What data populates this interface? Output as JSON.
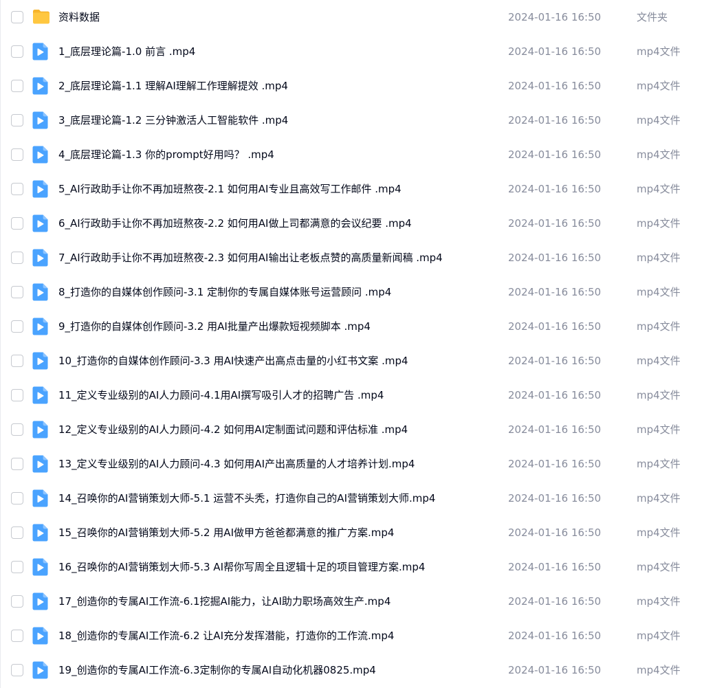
{
  "colors": {
    "video_icon": "#4aa3ff",
    "folder_icon": "#ffc740",
    "text_primary": "#03081a",
    "text_secondary": "#878c9c"
  },
  "files": [
    {
      "name": "资料数据",
      "date": "2024-01-16 16:50",
      "type": "文件夹",
      "icon": "folder-icon"
    },
    {
      "name": "1_底层理论篇-1.0 前言 .mp4",
      "date": "2024-01-16 16:50",
      "type": "mp4文件",
      "icon": "video-file-icon"
    },
    {
      "name": "2_底层理论篇-1.1 理解AI理解工作理解提效 .mp4",
      "date": "2024-01-16 16:50",
      "type": "mp4文件",
      "icon": "video-file-icon"
    },
    {
      "name": "3_底层理论篇-1.2 三分钟激活人工智能软件 .mp4",
      "date": "2024-01-16 16:50",
      "type": "mp4文件",
      "icon": "video-file-icon"
    },
    {
      "name": "4_底层理论篇-1.3 你的prompt好用吗？ .mp4",
      "date": "2024-01-16 16:50",
      "type": "mp4文件",
      "icon": "video-file-icon"
    },
    {
      "name": "5_AI行政助手让你不再加班熬夜-2.1 如何用AI专业且高效写工作邮件 .mp4",
      "date": "2024-01-16 16:50",
      "type": "mp4文件",
      "icon": "video-file-icon"
    },
    {
      "name": "6_AI行政助手让你不再加班熬夜-2.2 如何用AI做上司都满意的会议纪要 .mp4",
      "date": "2024-01-16 16:50",
      "type": "mp4文件",
      "icon": "video-file-icon"
    },
    {
      "name": "7_AI行政助手让你不再加班熬夜-2.3 如何用AI输出让老板点赞的高质量新闻稿 .mp4",
      "date": "2024-01-16 16:50",
      "type": "mp4文件",
      "icon": "video-file-icon"
    },
    {
      "name": "8_打造你的自媒体创作顾问-3.1 定制你的专属自媒体账号运营顾问 .mp4",
      "date": "2024-01-16 16:50",
      "type": "mp4文件",
      "icon": "video-file-icon"
    },
    {
      "name": "9_打造你的自媒体创作顾问-3.2 用AI批量产出爆款短视频脚本 .mp4",
      "date": "2024-01-16 16:50",
      "type": "mp4文件",
      "icon": "video-file-icon"
    },
    {
      "name": "10_打造你的自媒体创作顾问-3.3 用AI快速产出高点击量的小红书文案 .mp4",
      "date": "2024-01-16 16:50",
      "type": "mp4文件",
      "icon": "video-file-icon"
    },
    {
      "name": "11_定义专业级别的AI人力顾问-4.1用AI撰写吸引人才的招聘广告 .mp4",
      "date": "2024-01-16 16:50",
      "type": "mp4文件",
      "icon": "video-file-icon"
    },
    {
      "name": "12_定义专业级别的AI人力顾问-4.2 如何用AI定制面试问题和评估标准 .mp4",
      "date": "2024-01-16 16:50",
      "type": "mp4文件",
      "icon": "video-file-icon"
    },
    {
      "name": "13_定义专业级别的AI人力顾问-4.3 如何用AI产出高质量的人才培养计划.mp4",
      "date": "2024-01-16 16:50",
      "type": "mp4文件",
      "icon": "video-file-icon"
    },
    {
      "name": "14_召唤你的AI营销策划大师-5.1 运营不头秃，打造你自己的AI营销策划大师.mp4",
      "date": "2024-01-16 16:50",
      "type": "mp4文件",
      "icon": "video-file-icon"
    },
    {
      "name": "15_召唤你的AI营销策划大师-5.2 用AI做甲方爸爸都满意的推广方案.mp4",
      "date": "2024-01-16 16:50",
      "type": "mp4文件",
      "icon": "video-file-icon"
    },
    {
      "name": "16_召唤你的AI营销策划大师-5.3 AI帮你写周全且逻辑十足的项目管理方案.mp4",
      "date": "2024-01-16 16:50",
      "type": "mp4文件",
      "icon": "video-file-icon"
    },
    {
      "name": "17_创造你的专属AI工作流-6.1挖掘AI能力，让AI助力职场高效生产.mp4",
      "date": "2024-01-16 16:50",
      "type": "mp4文件",
      "icon": "video-file-icon"
    },
    {
      "name": "18_创造你的专属AI工作流-6.2 让AI充分发挥潜能，打造你的工作流.mp4",
      "date": "2024-01-16 16:50",
      "type": "mp4文件",
      "icon": "video-file-icon"
    },
    {
      "name": "19_创造你的专属AI工作流-6.3定制你的专属AI自动化机器0825.mp4",
      "date": "2024-01-16 16:50",
      "type": "mp4文件",
      "icon": "video-file-icon"
    }
  ]
}
